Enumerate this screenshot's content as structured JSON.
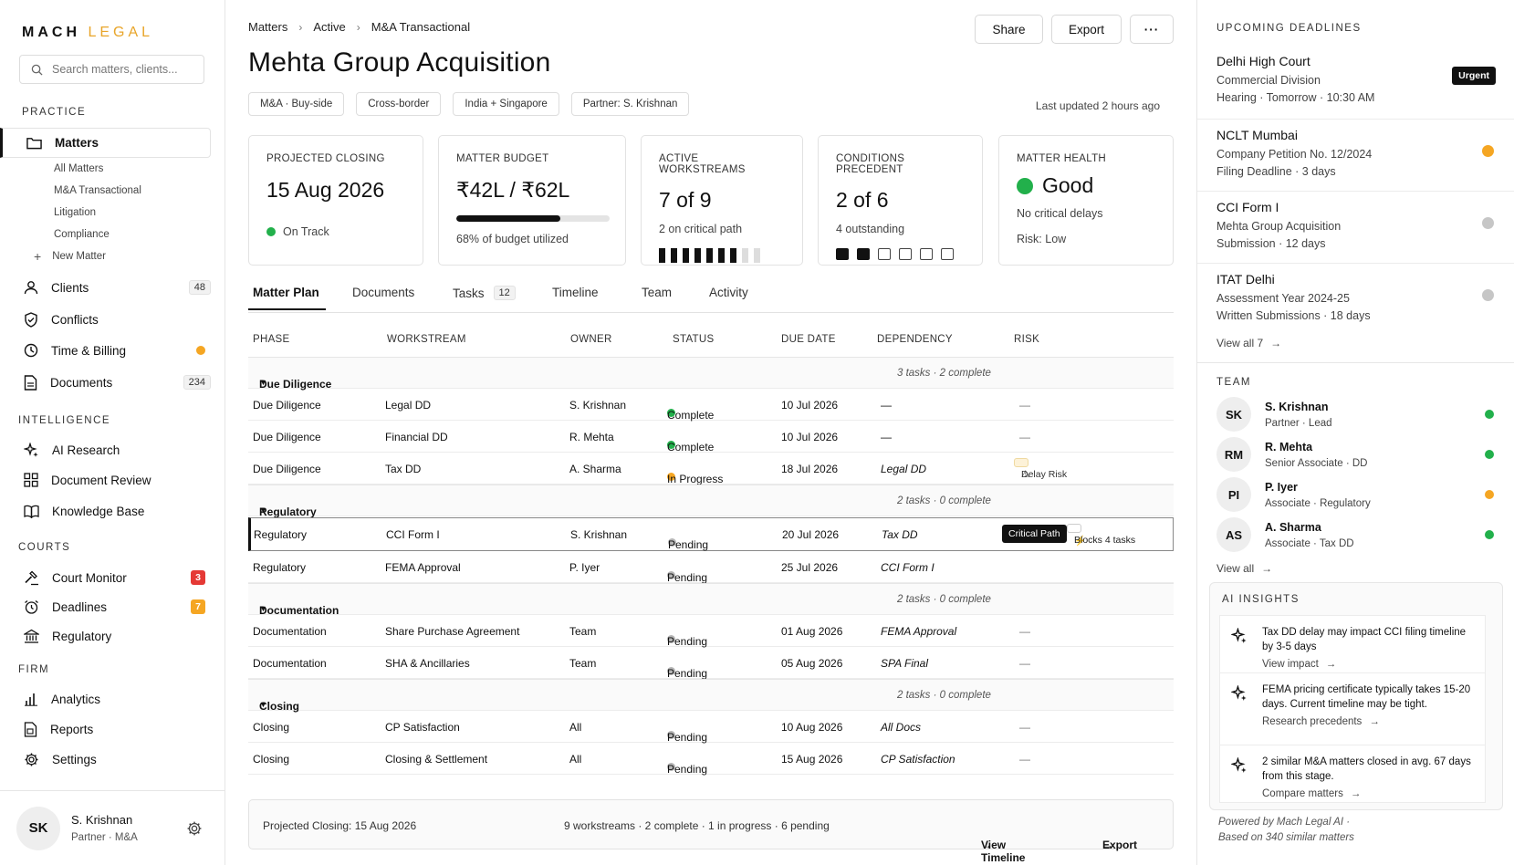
{
  "brand": {
    "part1": "MACH",
    "part2": "LEGAL",
    "accent": "#e8a52a"
  },
  "search": {
    "placeholder": "Search matters, clients..."
  },
  "sidebar": {
    "practice_title": "PRACTICE",
    "matters": "Matters",
    "matter_subs": [
      "All Matters",
      "M&A Transactional",
      "Litigation",
      "Compliance",
      "New Matter"
    ],
    "clients": {
      "label": "Clients",
      "count": "48"
    },
    "conflicts": "Conflicts",
    "time_billing": "Time & Billing",
    "documents": {
      "label": "Documents",
      "count": "234"
    },
    "intelligence_title": "INTELLIGENCE",
    "ai_research": "AI Research",
    "document_review": "Document Review",
    "knowledge_base": "Knowledge Base",
    "courts_title": "COURTS",
    "court_monitor": {
      "label": "Court Monitor",
      "badge": "3"
    },
    "deadlines": {
      "label": "Deadlines",
      "badge": "7"
    },
    "regulatory": "Regulatory",
    "firm_title": "FIRM",
    "analytics": "Analytics",
    "reports": "Reports",
    "settings": "Settings"
  },
  "user": {
    "initials": "SK",
    "name": "S. Krishnan",
    "role": "Partner · M&A"
  },
  "breadcrumb": [
    "Matters",
    "Active",
    "M&A Transactional"
  ],
  "actions": {
    "share": "Share",
    "export": "Export",
    "more": "···"
  },
  "title": "Mehta Group Acquisition",
  "tags": [
    "M&A · Buy-side",
    "Cross-border",
    "India + Singapore",
    "Partner: S. Krishnan"
  ],
  "last_updated": "Last updated 2 hours ago",
  "cards": {
    "closing": {
      "title": "PROJECTED CLOSING",
      "value": "15 Aug 2026",
      "status": "On Track"
    },
    "budget": {
      "title": "MATTER BUDGET",
      "value": "₹42L / ₹62L",
      "pct": 68,
      "sub": "68% of budget utilized"
    },
    "workstreams": {
      "title": "ACTIVE WORKSTREAMS",
      "value": "7 of 9",
      "sub": "2 on critical path",
      "done": 7,
      "total": 9
    },
    "conditions": {
      "title": "CONDITIONS PRECEDENT",
      "value": "2 of 6",
      "sub": "4 outstanding",
      "done": 2,
      "total": 6
    },
    "health": {
      "title": "MATTER HEALTH",
      "value": "Good",
      "sub": "No critical delays",
      "risk": "Risk:  Low"
    }
  },
  "tabs": {
    "plan": "Matter Plan",
    "documents": "Documents",
    "tasks": "Tasks",
    "tasks_count": "12",
    "timeline": "Timeline",
    "team": "Team",
    "activity": "Activity"
  },
  "table": {
    "headers": [
      "PHASE",
      "WORKSTREAM",
      "OWNER",
      "STATUS",
      "DUE DATE",
      "DEPENDENCY",
      "RISK"
    ],
    "groups": [
      {
        "name": "Due Diligence",
        "meta": "3 tasks  ·  2 complete"
      },
      {
        "name": "Regulatory",
        "meta": "2 tasks  ·  0 complete"
      },
      {
        "name": "Documentation",
        "meta": "2 tasks  ·  0 complete"
      },
      {
        "name": "Closing",
        "meta": "2 tasks  ·  0 complete"
      }
    ],
    "rows": [
      {
        "phase": "Due Diligence",
        "ws": "Legal DD",
        "owner": "S. Krishnan",
        "status": "Complete",
        "due": "10 Jul 2026",
        "dep": "—",
        "risk": "—"
      },
      {
        "phase": "Due Diligence",
        "ws": "Financial DD",
        "owner": "R. Mehta",
        "status": "Complete",
        "due": "10 Jul 2026",
        "dep": "—",
        "risk": "—"
      },
      {
        "phase": "Due Diligence",
        "ws": "Tax DD",
        "owner": "A. Sharma",
        "status": "In Progress",
        "due": "18 Jul 2026",
        "dep": "Legal DD",
        "risk": "Delay Risk"
      },
      {
        "phase": "Regulatory",
        "ws": "CCI Form I",
        "owner": "S. Krishnan",
        "status": "Pending",
        "due": "20 Jul 2026",
        "dep": "Tax DD",
        "risk": "Critical Path",
        "risk2": "Blocks 4 tasks"
      },
      {
        "phase": "Regulatory",
        "ws": "FEMA Approval",
        "owner": "P. Iyer",
        "status": "Pending",
        "due": "25 Jul 2026",
        "dep": "CCI Form I",
        "risk": ""
      },
      {
        "phase": "Documentation",
        "ws": "Share Purchase Agreement",
        "owner": "Team",
        "status": "Pending",
        "due": "01 Aug 2026",
        "dep": "FEMA Approval",
        "risk": "—"
      },
      {
        "phase": "Documentation",
        "ws": "SHA & Ancillaries",
        "owner": "Team",
        "status": "Pending",
        "due": "05 Aug 2026",
        "dep": "SPA Final",
        "risk": "—"
      },
      {
        "phase": "Closing",
        "ws": "CP Satisfaction",
        "owner": "All",
        "status": "Pending",
        "due": "10 Aug 2026",
        "dep": "All Docs",
        "risk": "—"
      },
      {
        "phase": "Closing",
        "ws": "Closing & Settlement",
        "owner": "All",
        "status": "Pending",
        "due": "15 Aug 2026",
        "dep": "CP Satisfaction",
        "risk": "—"
      }
    ]
  },
  "footer": {
    "closing": "Projected Closing: 15 Aug 2026",
    "summary": "9 workstreams  ·  2 complete  ·  1 in progress  ·  6 pending",
    "view_timeline": "View Timeline",
    "export": "Export"
  },
  "deadlines": {
    "title": "UPCOMING DEADLINES",
    "items": [
      {
        "title": "Delhi High Court",
        "sub": "Commercial Division",
        "detail": "Hearing · Tomorrow · 10:30 AM",
        "badge": "Urgent"
      },
      {
        "title": "NCLT Mumbai",
        "sub": "Company Petition No. 12/2024",
        "detail": "Filing Deadline · 3 days"
      },
      {
        "title": "CCI Form I",
        "sub": "Mehta Group Acquisition",
        "detail": "Submission · 12 days"
      },
      {
        "title": "ITAT Delhi",
        "sub": "Assessment Year 2024-25",
        "detail": "Written Submissions · 18 days"
      }
    ],
    "view_all": "View all 7"
  },
  "team": {
    "title": "TEAM",
    "members": [
      {
        "initials": "SK",
        "name": "S. Krishnan",
        "role": "Partner · Lead"
      },
      {
        "initials": "RM",
        "name": "R. Mehta",
        "role": "Senior Associate · DD"
      },
      {
        "initials": "PI",
        "name": "P. Iyer",
        "role": "Associate · Regulatory"
      },
      {
        "initials": "AS",
        "name": "A. Sharma",
        "role": "Associate · Tax DD"
      }
    ],
    "view_all": "View all"
  },
  "ai": {
    "title": "AI INSIGHTS",
    "insights": [
      {
        "text": "Tax DD delay may impact CCI filing timeline by 3-5 days",
        "link": "View impact"
      },
      {
        "text": "FEMA pricing certificate typically takes 15-20 days. Current timeline may be tight.",
        "link": "Research precedents"
      },
      {
        "text": "2 similar M&A matters closed in avg. 67 days from this stage.",
        "link": "Compare matters"
      }
    ],
    "powered": "Powered by Mach Legal AI ·",
    "based": "Based on 340 similar matters"
  },
  "colors": {
    "green": "#22b04b",
    "orange": "#f5a623",
    "red": "#e53935",
    "grey": "#b5b5b5"
  }
}
